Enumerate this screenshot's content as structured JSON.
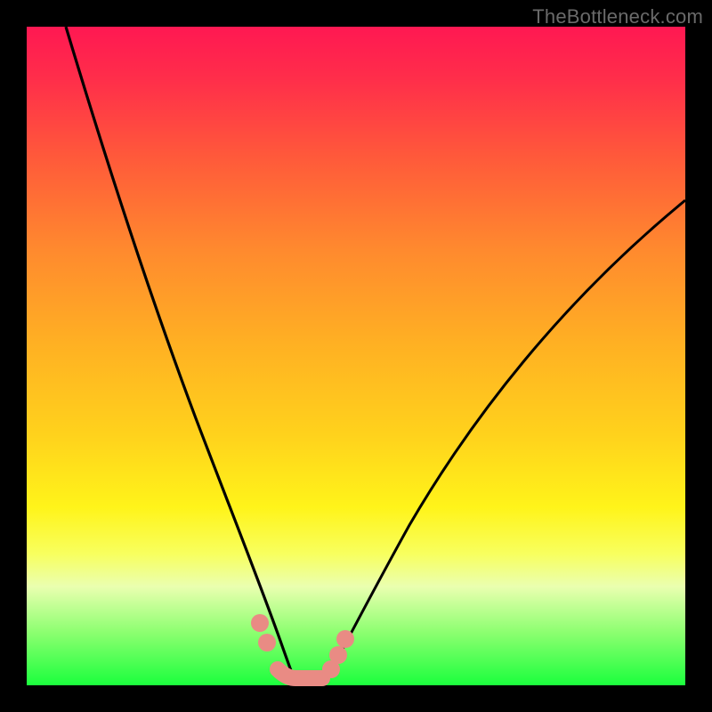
{
  "watermark": "TheBottleneck.com",
  "colors": {
    "background": "#000000",
    "gradient_top": "#ff1852",
    "gradient_mid": "#ffd21c",
    "gradient_bottom": "#1bff3d",
    "curve": "#000000",
    "markers": "#e98b84"
  },
  "chart_data": {
    "type": "line",
    "title": "",
    "xlabel": "",
    "ylabel": "",
    "xlim": [
      0,
      100
    ],
    "ylim": [
      0,
      100
    ],
    "series": [
      {
        "name": "left-curve",
        "x": [
          6,
          10,
          14,
          18,
          22,
          26,
          30,
          33,
          35,
          37,
          39,
          40
        ],
        "y": [
          100,
          86,
          72,
          58,
          45,
          33,
          22,
          14,
          9,
          5,
          2,
          0
        ]
      },
      {
        "name": "right-curve",
        "x": [
          45,
          48,
          52,
          56,
          62,
          70,
          80,
          90,
          100
        ],
        "y": [
          0,
          3,
          8,
          14,
          23,
          35,
          49,
          62,
          74
        ]
      }
    ],
    "markers": [
      {
        "series": "left-curve",
        "x": 35,
        "y": 9
      },
      {
        "series": "left-curve",
        "x": 36,
        "y": 6
      },
      {
        "series": "left-curve",
        "x": 39,
        "y": 2
      },
      {
        "series": "right-curve",
        "x": 45,
        "y": 0
      },
      {
        "series": "right-curve",
        "x": 46,
        "y": 2
      },
      {
        "series": "right-curve",
        "x": 47,
        "y": 4
      },
      {
        "series": "right-curve",
        "x": 48,
        "y": 6
      }
    ],
    "valley_connector": {
      "x": [
        39,
        40,
        42,
        44,
        45
      ],
      "y": [
        2,
        0,
        0,
        0,
        0
      ]
    }
  }
}
